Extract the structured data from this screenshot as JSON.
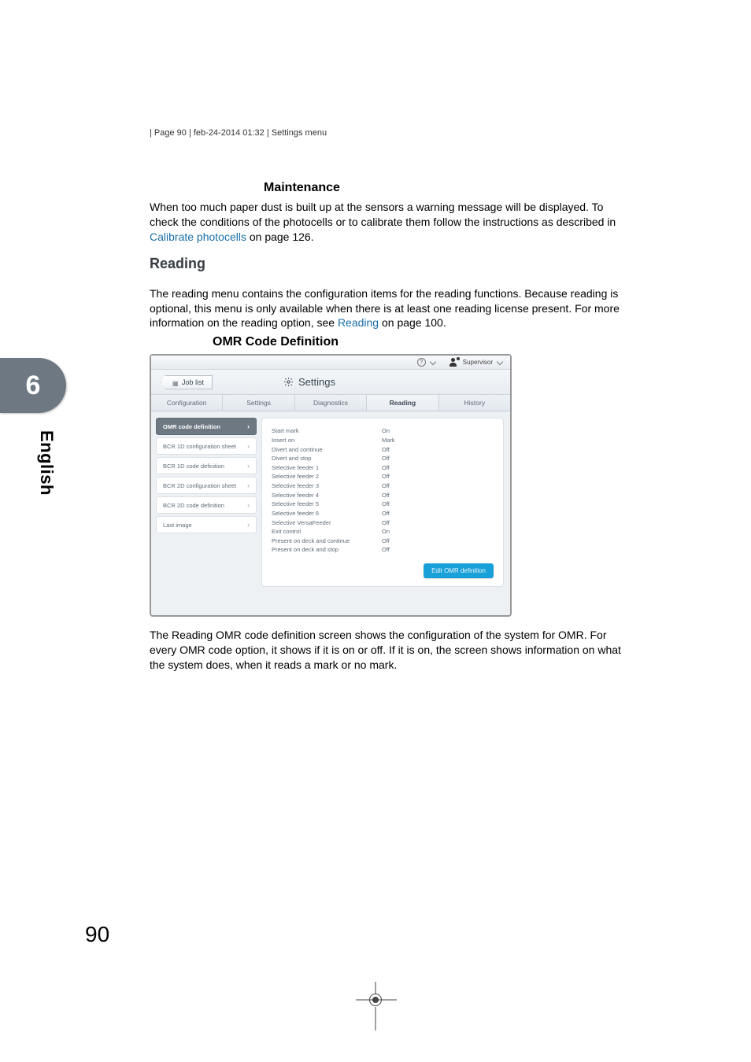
{
  "header_line": "| Page 90 | feb-24-2014 01:32 | Settings menu",
  "maintenance": {
    "heading": "Maintenance",
    "body_part1": "When too much paper dust is built up at the sensors a warning message will be displayed. To check the conditions of the photocells or to calibrate them follow the instructions as described in ",
    "link": "Calibrate photocells",
    "body_part2": " on page 126."
  },
  "reading": {
    "heading": "Reading",
    "body_part1": "The reading menu contains the configuration items for the reading functions. Because reading is optional, this menu is only available when there is at least one reading license present. For more information on the reading option, see ",
    "link": "Reading",
    "body_part2": " on page 100."
  },
  "omr": {
    "heading": "OMR Code Definition",
    "after_part1": "The Reading OMR code definition screen shows the configuration of the system for OMR. For every OMR code option, it shows if it is on or off. If it is on, the screen shows information on what the system does, when it reads a mark or no mark."
  },
  "screenshot": {
    "topbar": {
      "supervisor": "Supervisor"
    },
    "job_list_label": "Job list",
    "settings_title": "Settings",
    "tabs": [
      "Configuration",
      "Settings",
      "Diagnostics",
      "Reading",
      "History"
    ],
    "active_tab_index": 3,
    "sidebar_items": [
      "OMR code definition",
      "BCR 1D configuration sheet",
      "BCR 1D code definition",
      "BCR 2D configuration sheet",
      "BCR 2D code definition",
      "Last image"
    ],
    "sidebar_selected_index": 0,
    "detail_rows": [
      {
        "k": "Start mark",
        "v": "On"
      },
      {
        "k": "Insert on",
        "v": "Mark"
      },
      {
        "k": "Divert and continue",
        "v": "Off"
      },
      {
        "k": "Divert and stop",
        "v": "Off"
      },
      {
        "k": "Selective feeder 1",
        "v": "Off"
      },
      {
        "k": "Selective feeder 2",
        "v": "Off"
      },
      {
        "k": "Selective feeder 3",
        "v": "Off"
      },
      {
        "k": "Selective feeder 4",
        "v": "Off"
      },
      {
        "k": "Selective feeder 5",
        "v": "Off"
      },
      {
        "k": "Selective feeder 6",
        "v": "Off"
      },
      {
        "k": "Selective VersaFeeder",
        "v": "Off"
      },
      {
        "k": "Exit control",
        "v": "On"
      },
      {
        "k": "Present on deck and continue",
        "v": "Off"
      },
      {
        "k": "Present on deck and stop",
        "v": "Off"
      }
    ],
    "edit_button_label": "Edit OMR definition"
  },
  "side_tab": {
    "number": "6",
    "language": "English"
  },
  "page_number": "90"
}
